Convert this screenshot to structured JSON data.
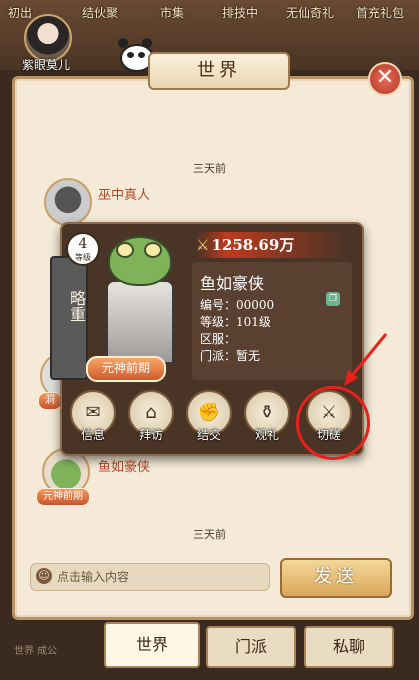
{
  "top_tabs": [
    "初出",
    "结伙聚",
    "市集",
    "排技中",
    "无仙奇礼",
    "首充礼包"
  ],
  "player_avatar": {
    "name": "紫眼莫儿"
  },
  "panel": {
    "title": "世界"
  },
  "messages": {
    "timestamp_1": "三天前",
    "msg1_name": "巫中真人",
    "msg2_name": "鱼如豪侠",
    "msg2_badge": "元神前期",
    "timestamp_2": "三天前",
    "partial_badge": "洞"
  },
  "popup": {
    "power": "1258.69万",
    "name": "鱼如豪侠",
    "id_label": "编号：",
    "id_value": "00000",
    "level_label": "等级：",
    "level_value": "101级",
    "server_label": "区服：",
    "server_value": "",
    "sect_label": "门派：",
    "sect_value": "暂无",
    "level_badge_number": "4",
    "level_badge_text": "等级",
    "sword_text": "略重",
    "realm": "元神前期",
    "actions": [
      {
        "label": "信息",
        "icon": "letter-icon"
      },
      {
        "label": "拜访",
        "icon": "house-icon"
      },
      {
        "label": "结交",
        "icon": "fist-icon"
      },
      {
        "label": "观礼",
        "icon": "wine-icon"
      },
      {
        "label": "切磋",
        "icon": "crossed-swords-icon"
      }
    ]
  },
  "chat": {
    "placeholder": "点击输入内容",
    "send_label": "发送"
  },
  "bottom_tabs": [
    {
      "label": "世界",
      "active": true
    },
    {
      "label": "门派",
      "active": false
    },
    {
      "label": "私聊",
      "active": false
    }
  ],
  "bottom_strip": "世界 成公"
}
